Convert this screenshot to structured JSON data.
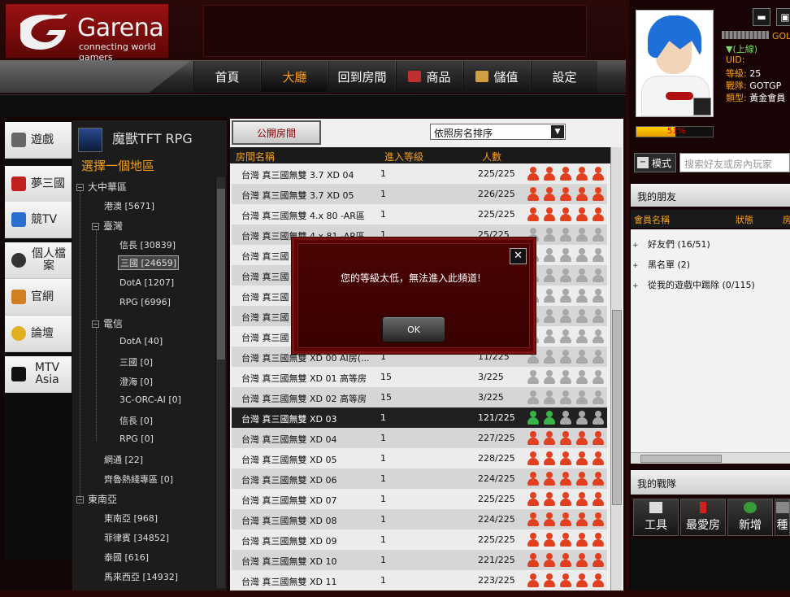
{
  "app": {
    "logo_name": "Garena",
    "logo_tagline": "connecting world gamers"
  },
  "nav": [
    {
      "label": "首頁",
      "active": false
    },
    {
      "label": "大廳",
      "active": true
    },
    {
      "label": "回到房間",
      "active": false
    },
    {
      "label": "商品",
      "active": false,
      "icon": "cart-icon"
    },
    {
      "label": "儲值",
      "active": false,
      "icon": "card-icon"
    },
    {
      "label": "設定",
      "active": false
    }
  ],
  "leftnav": [
    {
      "label": "遊戲",
      "icon": "game-icon",
      "color": "#555555"
    },
    {
      "label": "夢三國",
      "icon": "sword-icon",
      "color": "#c02020"
    },
    {
      "label": "競TV",
      "icon": "tv-icon",
      "color": "#2a6fd0"
    },
    {
      "label": "個人檔案",
      "icon": "user-icon",
      "color": "#333333"
    },
    {
      "label": "官網",
      "icon": "home-icon",
      "color": "#d08020"
    },
    {
      "label": "論壇",
      "icon": "chat-icon",
      "color": "#e0b020"
    },
    {
      "label": "MTV Asia",
      "icon": "mtv-icon",
      "color": "#111111"
    }
  ],
  "game": {
    "title": "魔獸TFT RPG",
    "icon_label": "WARCRAFT RPG",
    "region_title": "選擇一個地區"
  },
  "tree": {
    "root1": "大中華區",
    "hk": "港澳 [5671]",
    "tw": "臺灣",
    "tw_items": [
      "信長 [30839]",
      "三國 [24659]",
      "DotA [1207]",
      "RPG [6996]"
    ],
    "telecom": "電信",
    "telecom_items": [
      "DotA [40]",
      "三國 [0]",
      "澄海 [0]",
      "3C-ORC-AI [0]",
      "信長 [0]",
      "RPG [0]"
    ],
    "wangtong": "網通 [22]",
    "qilu": "齊魯熱綫專區 [0]",
    "root2": "東南亞",
    "sea_items": [
      "東南亞 [968]",
      "菲律賓 [34852]",
      "泰國 [616]",
      "馬來西亞 [14932]"
    ]
  },
  "rooms_header": {
    "tab_public": "公開房間",
    "sort": "依照房名排序",
    "col_name": "房間名稱",
    "col_level": "進入等級",
    "col_count": "人數"
  },
  "rooms": [
    {
      "name": "台灣 真三國無雙 3.7 XD 04",
      "level": "1",
      "count": "225/225",
      "players": "r"
    },
    {
      "name": "台灣 真三國無雙 3.7 XD 05",
      "level": "1",
      "count": "226/225",
      "players": "r"
    },
    {
      "name": "台灣 真三國無雙 4.x 80 -AR區",
      "level": "1",
      "count": "225/225",
      "players": "r"
    },
    {
      "name": "台灣 真三國無雙 4.x 81 -AR區",
      "level": "1",
      "count": "25/225",
      "players": "g"
    },
    {
      "name": "台灣 真三國",
      "level": "",
      "count": "",
      "players": "g"
    },
    {
      "name": "台灣 真三國",
      "level": "",
      "count": "",
      "players": "g"
    },
    {
      "name": "台灣 真三國",
      "level": "",
      "count": "",
      "players": "g"
    },
    {
      "name": "台灣 真三國",
      "level": "",
      "count": "",
      "players": "g"
    },
    {
      "name": "台灣 真三國",
      "level": "",
      "count": "",
      "players": "g"
    },
    {
      "name": "台灣 真三國無雙 XD 00 AI房(...",
      "level": "1",
      "count": "11/225",
      "players": "g"
    },
    {
      "name": "台灣 真三國無雙 XD 01 高等房",
      "level": "15",
      "count": "3/225",
      "players": "g"
    },
    {
      "name": "台灣 真三國無雙 XD 02 高等房",
      "level": "15",
      "count": "3/225",
      "players": "g"
    },
    {
      "name": "台灣 真三國無雙 XD 03",
      "level": "1",
      "count": "121/225",
      "players": "gr",
      "selected": true
    },
    {
      "name": "台灣 真三國無雙 XD 04",
      "level": "1",
      "count": "227/225",
      "players": "r"
    },
    {
      "name": "台灣 真三國無雙 XD 05",
      "level": "1",
      "count": "228/225",
      "players": "r"
    },
    {
      "name": "台灣 真三國無雙 XD 06",
      "level": "1",
      "count": "224/225",
      "players": "r"
    },
    {
      "name": "台灣 真三國無雙 XD 07",
      "level": "1",
      "count": "225/225",
      "players": "r"
    },
    {
      "name": "台灣 真三國無雙 XD 08",
      "level": "1",
      "count": "224/225",
      "players": "r"
    },
    {
      "name": "台灣 真三國無雙 XD 09",
      "level": "1",
      "count": "225/225",
      "players": "r"
    },
    {
      "name": "台灣 真三國無雙 XD 10",
      "level": "1",
      "count": "221/225",
      "players": "r"
    },
    {
      "name": "台灣 真三國無雙 XD 11",
      "level": "1",
      "count": "223/225",
      "players": "r"
    }
  ],
  "dialog": {
    "message": "您的等級太低，無法進入此頻道!",
    "ok": "OK",
    "close": "✕"
  },
  "user": {
    "tag": "GOL",
    "status": "▼(上線)",
    "uid_label": "UID:",
    "level_label": "等級: ",
    "level": "25",
    "clan_label": "戰隊: ",
    "clan": "GOTGP",
    "type_label": "類型: ",
    "type": "黃金會員",
    "exp_pct": 51,
    "exp_text": "51%"
  },
  "friends": {
    "mode": "模式",
    "search_placeholder": "搜索好友或房內玩家",
    "header": "我的朋友",
    "col_member": "會員名稱",
    "col_status": "狀態",
    "col_room": "房",
    "groups": [
      "好友們 (16/51)",
      "黑名單 (2)",
      "從我的遊戲中踢除 (0/115)"
    ]
  },
  "clan": {
    "header": "我的戰隊"
  },
  "tools": [
    {
      "label": "工具",
      "icon": "tools-icon"
    },
    {
      "label": "最愛房",
      "icon": "pin-icon"
    },
    {
      "label": "新增",
      "icon": "add-user-icon"
    },
    {
      "label": "種",
      "icon": "more-icon"
    }
  ],
  "colors": {
    "accent": "#f5a01a",
    "brand": "#9a1212"
  }
}
